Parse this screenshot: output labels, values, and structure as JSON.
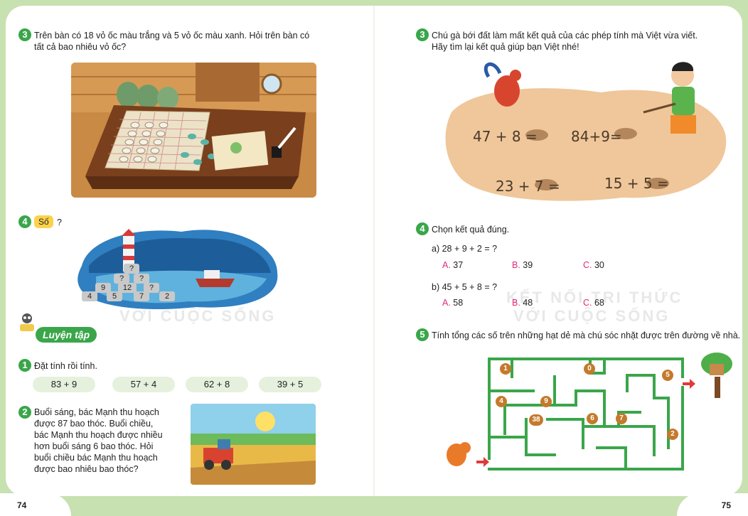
{
  "left_page": {
    "page_number": "74",
    "q3": {
      "number": "3",
      "text_line1": "Trên bàn có 18 vỏ ốc màu trắng và 5 vỏ ốc màu xanh. Hỏi trên bàn có",
      "text_line2": "tất cả bao nhiêu vỏ ốc?"
    },
    "q4": {
      "number": "4",
      "tag": "Số",
      "suffix": "?",
      "pyramid": {
        "top": "?",
        "row2": [
          "?",
          "?"
        ],
        "row3": [
          "9",
          "12",
          "?"
        ],
        "row4": [
          "4",
          "5",
          "7",
          "2"
        ]
      }
    },
    "section_label": "Luyện tập",
    "ex1": {
      "number": "1",
      "text": "Đặt tính rồi tính.",
      "items": [
        "83 + 9",
        "57 + 4",
        "62 + 8",
        "39 + 5"
      ]
    },
    "ex2": {
      "number": "2",
      "lines": [
        "Buổi sáng, bác Mạnh thu hoạch",
        "được 87 bao thóc. Buổi chiều,",
        "bác Mạnh thu hoạch được nhiều",
        "hơn buổi sáng 6 bao thóc. Hỏi",
        "buổi chiều bác Mạnh thu hoạch",
        "được bao nhiêu bao thóc?"
      ]
    },
    "watermark_line": "VỚI CUỘC SỐNG"
  },
  "right_page": {
    "page_number": "75",
    "q3": {
      "number": "3",
      "text_line1": "Chú gà bới đất làm mất kết quả của các phép tính mà Việt vừa viết.",
      "text_line2": "Hãy tìm lại kết quả giúp bạn Việt nhé!",
      "sums": [
        "47 + 8 =",
        "84+9=",
        "23 + 7 =",
        "15 + 5 ="
      ]
    },
    "q4": {
      "number": "4",
      "text": "Chọn kết quả đúng.",
      "a": {
        "prompt": "a) 28 + 9 + 2 = ?",
        "options": [
          {
            "letter": "A.",
            "value": "37"
          },
          {
            "letter": "B.",
            "value": "39"
          },
          {
            "letter": "C.",
            "value": "30"
          }
        ]
      },
      "b": {
        "prompt": "b) 45 + 5 + 8 = ?",
        "options": [
          {
            "letter": "A.",
            "value": "58"
          },
          {
            "letter": "B.",
            "value": "48"
          },
          {
            "letter": "C.",
            "value": "68"
          }
        ]
      }
    },
    "q5": {
      "number": "5",
      "text": "Tính tổng các số trên những hạt dẻ mà chú sóc nhặt được trên đường về nhà.",
      "nuts": [
        "1",
        "0",
        "5",
        "4",
        "9",
        "38",
        "6",
        "7",
        "2"
      ]
    },
    "watermark_line1": "KẾT NỐI TRI THỨC",
    "watermark_line2": "VỚI CUỘC SỐNG"
  },
  "colors": {
    "badge_green": "#3aa64a",
    "option_pink": "#e3287a",
    "tag_yellow": "#fbd24a",
    "pill_bg": "#e6f1dd",
    "maze_green": "#3aa64a"
  }
}
